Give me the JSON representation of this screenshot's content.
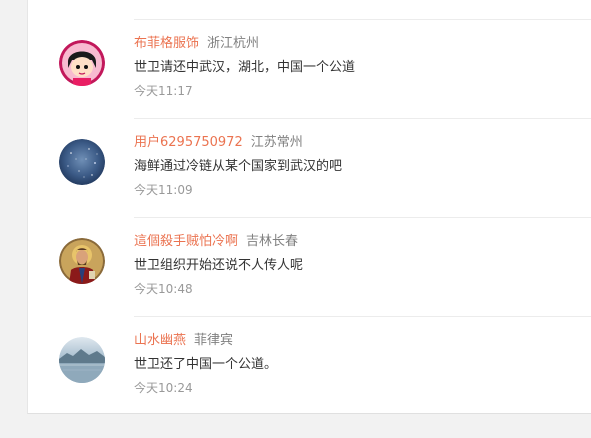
{
  "comments": [
    {
      "username": "布菲格服饰",
      "location": "浙江杭州",
      "text": "世卫请还中武汉，湖北，中国一个公道",
      "time": "今天11:17",
      "avatar_icon": "cartoon-girl-avatar"
    },
    {
      "username": "用户6295750972",
      "location": "江苏常州",
      "text": "海鲜通过冷链从某个国家到武汉的吧",
      "time": "今天11:09",
      "avatar_icon": "starry-sky-avatar"
    },
    {
      "username": "這個殺手贼怕冷啊",
      "location": "吉林长春",
      "text": "世卫组织开始还说不人传人呢",
      "time": "今天10:48",
      "avatar_icon": "icon-painting-avatar"
    },
    {
      "username": "山水幽燕",
      "location": "菲律宾",
      "text": "世卫还了中国一个公道。",
      "time": "今天10:24",
      "avatar_icon": "lake-landscape-avatar"
    }
  ],
  "colors": {
    "username": "#eb7350",
    "location": "#808080",
    "text": "#333333",
    "time": "#999999"
  }
}
